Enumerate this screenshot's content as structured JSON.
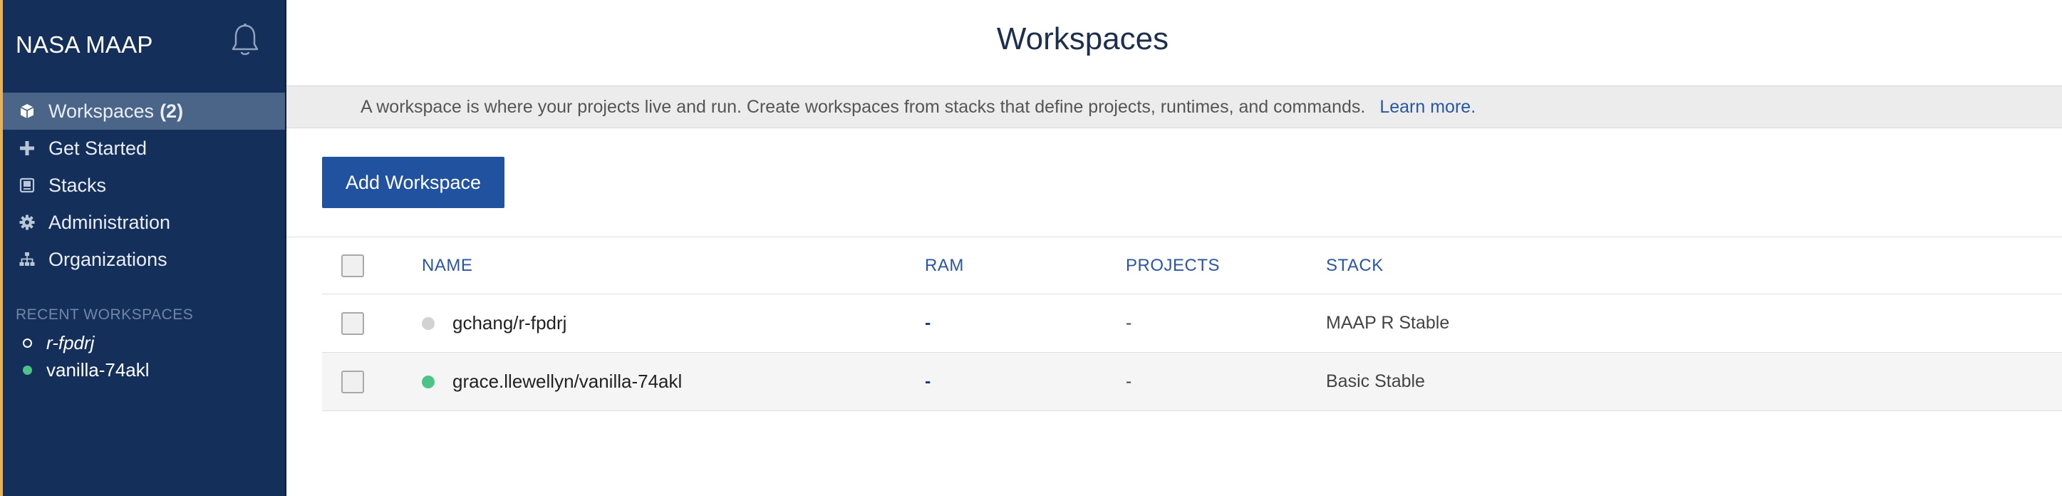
{
  "sidebar": {
    "brand": "NASA MAAP",
    "nav": [
      {
        "label": "Workspaces",
        "count": "(2)",
        "icon": "cube-icon",
        "active": true
      },
      {
        "label": "Get Started",
        "icon": "plus-icon"
      },
      {
        "label": "Stacks",
        "icon": "stack-icon"
      },
      {
        "label": "Administration",
        "icon": "gear-icon"
      },
      {
        "label": "Organizations",
        "icon": "org-chart-icon"
      }
    ],
    "recent_title": "RECENT WORKSPACES",
    "recent": [
      {
        "name": "r-fpdrj",
        "status": "stopped"
      },
      {
        "name": "vanilla-74akl",
        "status": "running"
      }
    ]
  },
  "main": {
    "title": "Workspaces",
    "info_text": "A workspace is where your projects live and run. Create workspaces from stacks that define projects, runtimes, and commands.",
    "learn_more": "Learn more.",
    "add_button": "Add Workspace",
    "table": {
      "headers": {
        "name": "NAME",
        "ram": "RAM",
        "projects": "PROJECTS",
        "stack": "STACK"
      },
      "rows": [
        {
          "name": "gchang/r-fpdrj",
          "status": "stopped",
          "ram": "-",
          "projects": "-",
          "stack": "MAAP R Stable"
        },
        {
          "name": "grace.llewellyn/vanilla-74akl",
          "status": "running",
          "ram": "-",
          "projects": "-",
          "stack": "Basic Stable"
        }
      ]
    }
  },
  "colors": {
    "sidebar_bg": "#14305a",
    "active_item": "#4a6587",
    "accent_blue": "#2152a0",
    "running": "#4cc487",
    "stopped": "#d2d2d2"
  }
}
